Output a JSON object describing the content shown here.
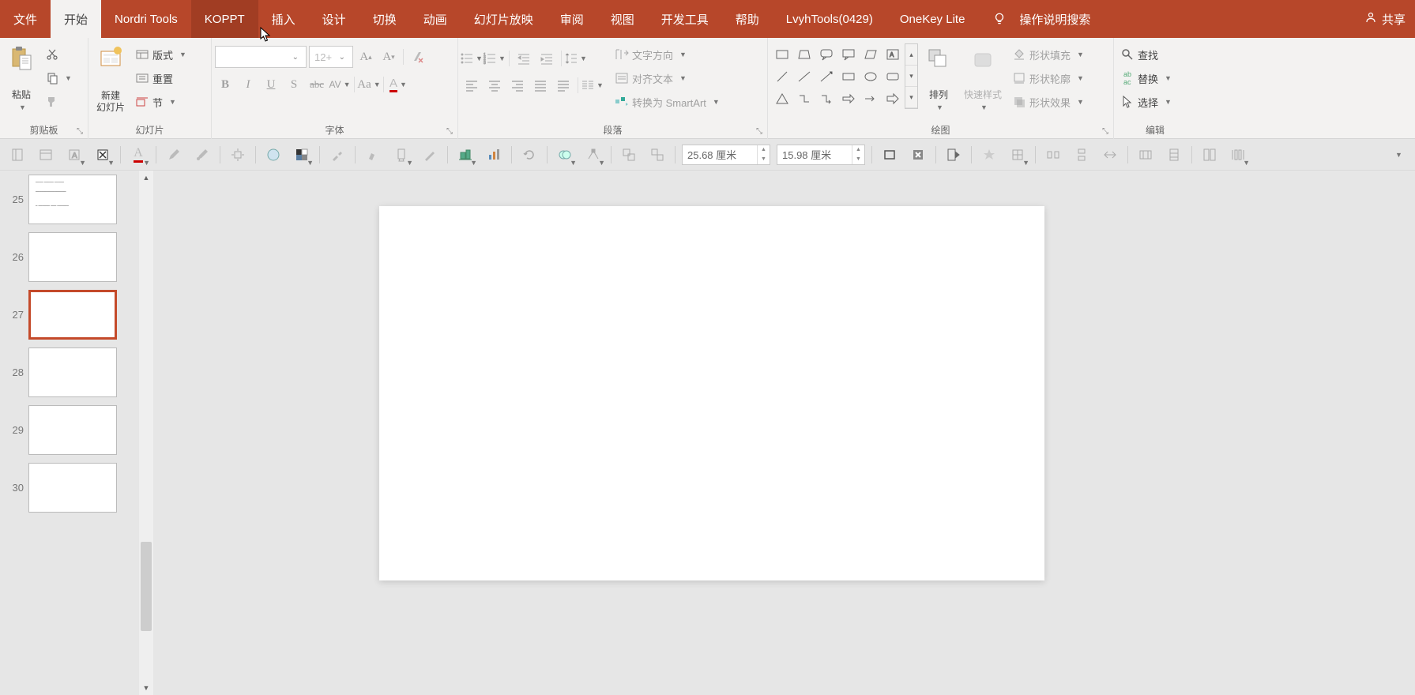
{
  "tabs": {
    "file": "文件",
    "home": "开始",
    "nordri": "Nordri Tools",
    "koppt": "KOPPT",
    "insert": "插入",
    "design": "设计",
    "transition": "切换",
    "anim": "动画",
    "slideshow": "幻灯片放映",
    "review": "审阅",
    "view": "视图",
    "dev": "开发工具",
    "help": "帮助",
    "lvyh": "LvyhTools(0429)",
    "onekey": "OneKey Lite",
    "tellme": "操作说明搜索",
    "share": "共享"
  },
  "ribbon": {
    "paste": "粘贴",
    "clipboard": "剪贴板",
    "new_slide": "新建\n幻灯片",
    "layout": "版式",
    "reset": "重置",
    "section": "节",
    "slides": "幻灯片",
    "font_size_ph": "12+",
    "font": "字体",
    "paragraph": "段落",
    "text_dir": "文字方向",
    "align_text": "对齐文本",
    "smartart": "转换为 SmartArt",
    "arrange": "排列",
    "quick_styles": "快速样式",
    "drawing": "绘图",
    "shape_fill": "形状填充",
    "shape_outline": "形状轮廓",
    "shape_effects": "形状效果",
    "find": "查找",
    "replace": "替换",
    "select": "选择",
    "editing": "编辑"
  },
  "qat": {
    "dim1": "25.68 厘米",
    "dim2": "15.98 厘米"
  },
  "thumbs": [
    {
      "n": 25,
      "content": true
    },
    {
      "n": 26
    },
    {
      "n": 27,
      "sel": true
    },
    {
      "n": 28
    },
    {
      "n": 29
    },
    {
      "n": 30
    }
  ]
}
